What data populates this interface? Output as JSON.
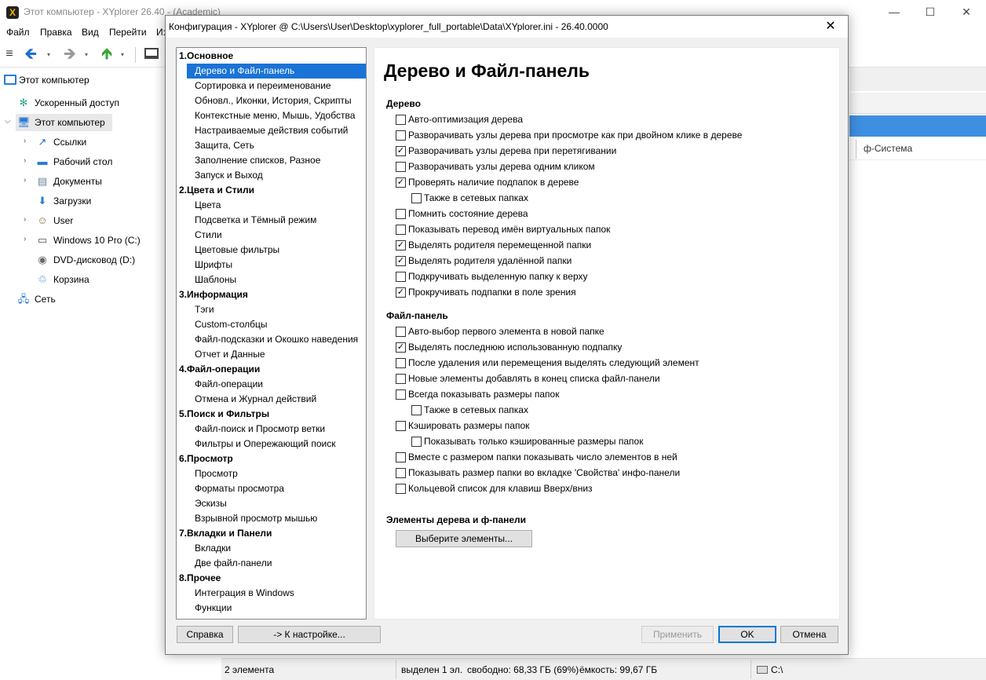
{
  "app": {
    "title": "Этот компьютер - XYplorer 26.40 - (Academic)",
    "icon_glyph": "X",
    "window_controls": {
      "minimize": "—",
      "maximize": "☐",
      "close": "✕"
    }
  },
  "menu": [
    "Файл",
    "Правка",
    "Вид",
    "Перейти",
    "И:"
  ],
  "toolbar": {
    "menu_glyph": "≡",
    "back": "🡸",
    "forward": "🡺",
    "up": "🡹",
    "drop": "▾"
  },
  "address": "Этот компьютер",
  "tree": [
    {
      "label": "Ускоренный доступ",
      "icon": "star-icon",
      "glyph": "✻",
      "color": "#2aa58c",
      "expander": ""
    },
    {
      "label": "Этот компьютер",
      "icon": "computer-icon",
      "glyph": "🖥",
      "color": "#2a7bd6",
      "expander": "⌵",
      "selected": true
    },
    {
      "label": "Ссылки",
      "icon": "links-icon",
      "glyph": "↗",
      "color": "#1f6fc2",
      "expander": "›"
    },
    {
      "label": "Рабочий стол",
      "icon": "desktop-icon",
      "glyph": "▬",
      "color": "#2a7bd6",
      "expander": "›"
    },
    {
      "label": "Документы",
      "icon": "documents-icon",
      "glyph": "▤",
      "color": "#6b7f99",
      "expander": "›"
    },
    {
      "label": "Загрузки",
      "icon": "downloads-icon",
      "glyph": "⬇",
      "color": "#2a7bd6",
      "expander": ""
    },
    {
      "label": "User",
      "icon": "user-icon",
      "glyph": "☺",
      "color": "#8a6a3a",
      "expander": "›"
    },
    {
      "label": "Windows 10 Pro (C:)",
      "icon": "drive-icon",
      "glyph": "▭",
      "color": "#555555",
      "expander": "›"
    },
    {
      "label": "DVD-дисковод (D:)",
      "icon": "dvd-icon",
      "glyph": "◉",
      "color": "#666666",
      "expander": ""
    },
    {
      "label": "Корзина",
      "icon": "recycle-bin-icon",
      "glyph": "♲",
      "color": "#3b7bd4",
      "expander": ""
    },
    {
      "label": "Сеть",
      "icon": "network-icon",
      "glyph": "🖧",
      "color": "#2a7bd6",
      "expander": ""
    }
  ],
  "right_pane": {
    "column_label": "ф-Система"
  },
  "status": {
    "items": "2 элемента",
    "selected": "выделен 1 эл.",
    "free": "свободно: 68,33 ГБ (69%)",
    "capacity": "ёмкость: 99,67 ГБ",
    "drive": "C:\\"
  },
  "dialog": {
    "title": "Конфигурация - XYplorer @ C:\\Users\\User\\Desktop\\xyplorer_full_portable\\Data\\XYplorer.ini - 26.40.0000",
    "close": "✕",
    "nav": [
      {
        "label": "1.Основное",
        "section": true
      },
      {
        "label": "Дерево и Файл-панель",
        "selected": true
      },
      {
        "label": "Сортировка и переименование"
      },
      {
        "label": "Обновл., Иконки, История, Скрипты"
      },
      {
        "label": "Контекстные меню, Мышь, Удобства"
      },
      {
        "label": "Настраиваемые действия событий"
      },
      {
        "label": "Защита, Сеть"
      },
      {
        "label": "Заполнение списков, Разное"
      },
      {
        "label": "Запуск и Выход"
      },
      {
        "label": "2.Цвета и Стили",
        "section": true
      },
      {
        "label": "Цвета"
      },
      {
        "label": "Подсветка и Тёмный режим"
      },
      {
        "label": "Стили"
      },
      {
        "label": "Цветовые фильтры"
      },
      {
        "label": "Шрифты"
      },
      {
        "label": "Шаблоны"
      },
      {
        "label": "3.Информация",
        "section": true
      },
      {
        "label": "Тэги"
      },
      {
        "label": "Custom-столбцы"
      },
      {
        "label": "Файл-подсказки и Окошко наведения"
      },
      {
        "label": "Отчет и Данные"
      },
      {
        "label": "4.Файл-операции",
        "section": true
      },
      {
        "label": "Файл-операции"
      },
      {
        "label": "Отмена и Журнал действий"
      },
      {
        "label": "5.Поиск и Фильтры",
        "section": true
      },
      {
        "label": "Файл-поиск и Просмотр ветки"
      },
      {
        "label": "Фильтры и Опережающий поиск"
      },
      {
        "label": "6.Просмотр",
        "section": true
      },
      {
        "label": "Просмотр"
      },
      {
        "label": "Форматы просмотра"
      },
      {
        "label": "Эскизы"
      },
      {
        "label": "Взрывной просмотр мышью"
      },
      {
        "label": "7.Вкладки и Панели",
        "section": true
      },
      {
        "label": "Вкладки"
      },
      {
        "label": "Две файл-панели"
      },
      {
        "label": "8.Прочее",
        "section": true
      },
      {
        "label": "Интеграция в Windows"
      },
      {
        "label": "Функции"
      }
    ],
    "panel": {
      "title": "Дерево и Файл-панель",
      "tree_group": {
        "label": "Дерево",
        "options": [
          {
            "label": "Авто-оптимизация дерева",
            "checked": false
          },
          {
            "label": "Разворачивать узлы дерева при просмотре как при двойном клике в дереве",
            "checked": false
          },
          {
            "label": "Разворачивать узлы дерева при перетягивании",
            "checked": true
          },
          {
            "label": "Разворачивать узлы дерева одним кликом",
            "checked": false
          },
          {
            "label": "Проверять наличие подпапок в дереве",
            "checked": true
          },
          {
            "label": "Также в сетевых папках",
            "checked": false,
            "indent": true
          },
          {
            "label": "Помнить состояние дерева",
            "checked": false
          },
          {
            "label": "Показывать перевод имён виртуальных папок",
            "checked": false
          },
          {
            "label": "Выделять родителя перемещенной папки",
            "checked": true
          },
          {
            "label": "Выделять родителя удалённой папки",
            "checked": true
          },
          {
            "label": "Подкручивать выделенную папку к верху",
            "checked": false
          },
          {
            "label": "Прокручивать подпапки в поле зрения",
            "checked": true
          }
        ]
      },
      "filepanel_group": {
        "label": "Файл-панель",
        "options": [
          {
            "label": "Авто-выбор первого элемента в новой папке",
            "checked": false
          },
          {
            "label": "Выделять последнюю использованную подпапку",
            "checked": true
          },
          {
            "label": "После удаления или перемещения выделять следующий элемент",
            "checked": false
          },
          {
            "label": "Новые элементы добавлять в конец списка файл-панели",
            "checked": false
          },
          {
            "label": "Всегда показывать размеры папок",
            "checked": false
          },
          {
            "label": "Также в сетевых папках",
            "checked": false,
            "indent": true
          },
          {
            "label": "Кэшировать размеры папок",
            "checked": false
          },
          {
            "label": "Показывать только кэшированные размеры папок",
            "checked": false,
            "indent": true
          },
          {
            "label": "Вместе с размером папки показывать число элементов в ней",
            "checked": false
          },
          {
            "label": "Показывать размер папки во вкладке 'Свойства' инфо-панели",
            "checked": false
          },
          {
            "label": "Кольцевой список для клавиш Вверх/вниз",
            "checked": false
          }
        ]
      },
      "elements_group": {
        "label": "Элементы дерева и ф-панели",
        "button": "Выберите элементы..."
      }
    },
    "buttons": {
      "help": "Справка",
      "goto_setting": "-> К настройке...",
      "apply": "Применить",
      "ok": "OK",
      "cancel": "Отмена"
    }
  },
  "colors": {
    "accent": "#1a73d6",
    "selection_blue": "#3e8fe0",
    "dialog_bg": "#f0f0f0"
  }
}
